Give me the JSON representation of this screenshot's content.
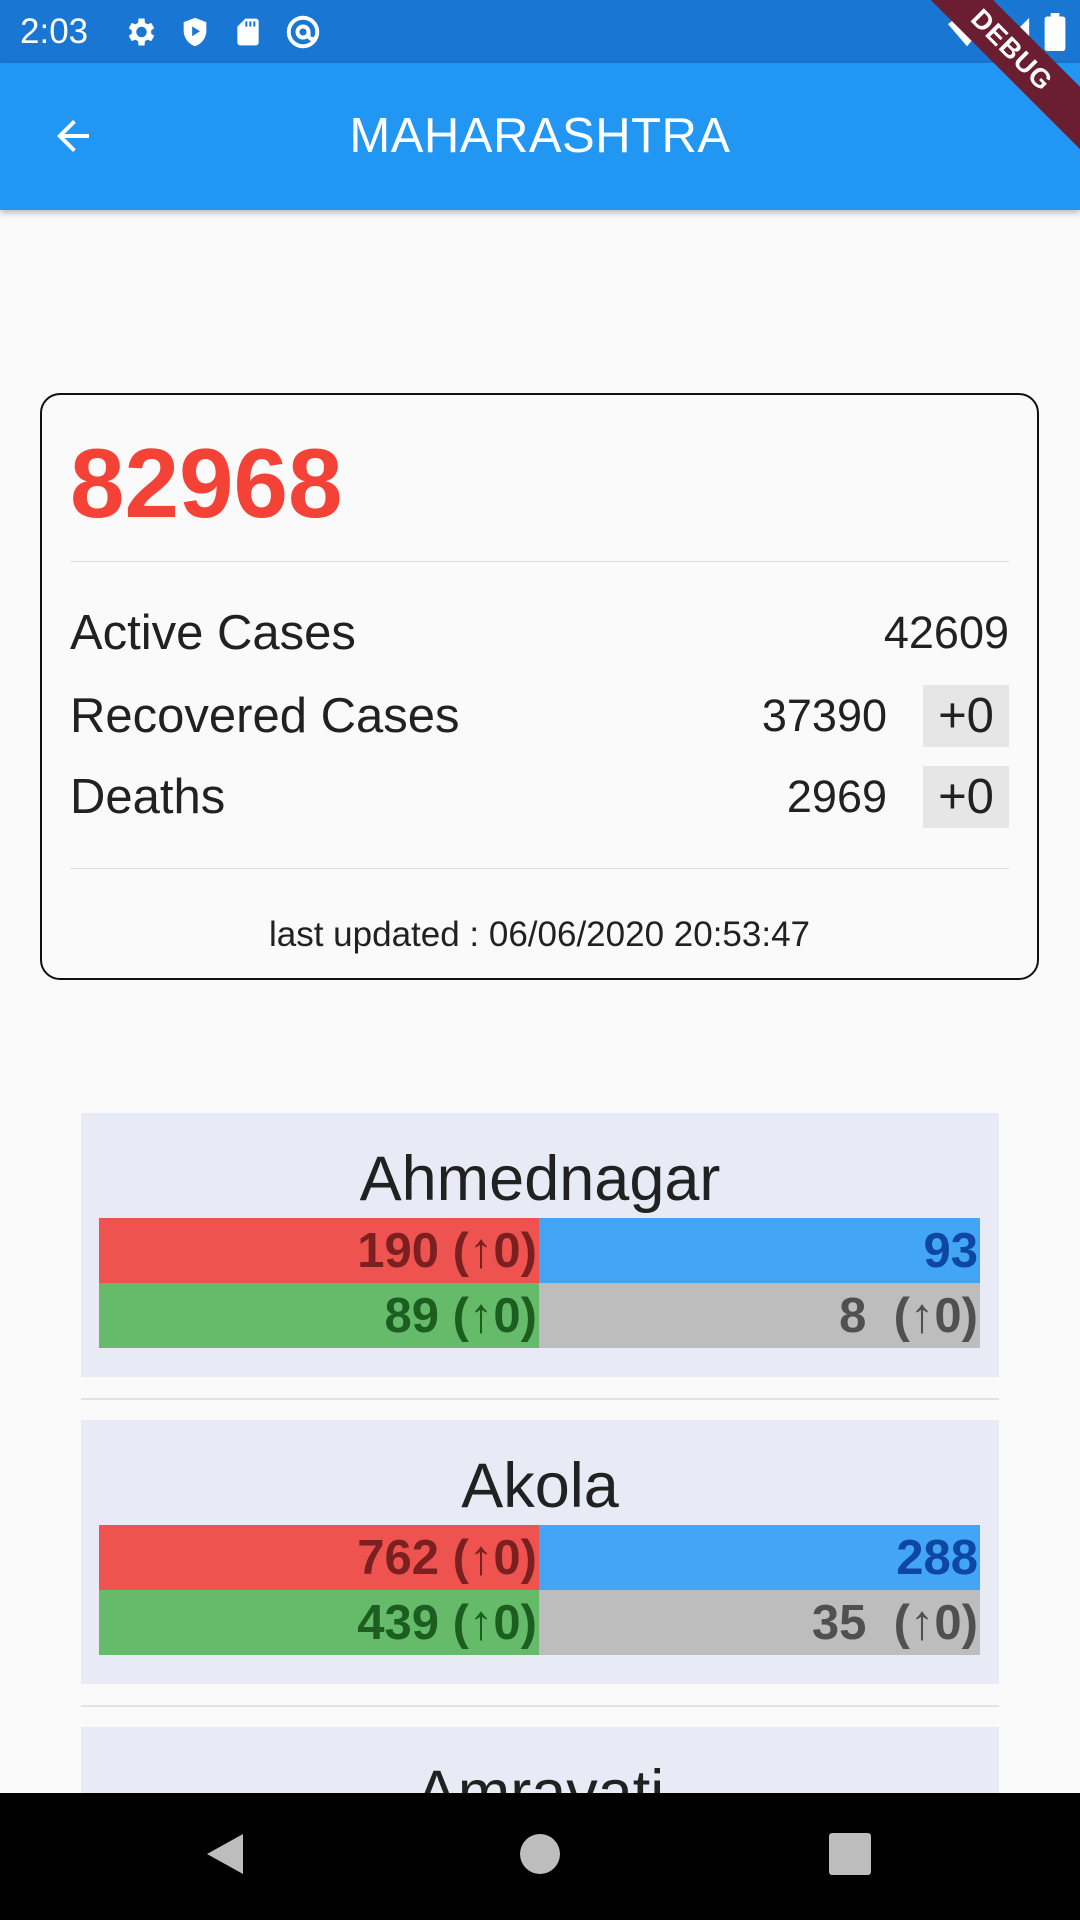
{
  "status_bar": {
    "time": "2:03"
  },
  "app_bar": {
    "title": "MAHARASHTRA",
    "debug_label": "DEBUG"
  },
  "summary": {
    "total": "82968",
    "rows": [
      {
        "label": "Active Cases",
        "value": "42609",
        "delta": ""
      },
      {
        "label": "Recovered Cases",
        "value": "37390",
        "delta": "+0"
      },
      {
        "label": "Deaths",
        "value": "2969",
        "delta": "+0"
      }
    ],
    "last_updated": "last updated : 06/06/2020 20:53:47"
  },
  "districts": [
    {
      "name": "Ahmednagar",
      "confirmed": "190 (↑0)",
      "active": "93",
      "recovered": "89 (↑0)",
      "deceased": "8  (↑0)"
    },
    {
      "name": "Akola",
      "confirmed": "762 (↑0)",
      "active": "288",
      "recovered": "439 (↑0)",
      "deceased": "35  (↑0)"
    },
    {
      "name": "Amravati",
      "confirmed": "",
      "active": "",
      "recovered": "",
      "deceased": ""
    }
  ],
  "colors": {
    "status_bar": "#1976d2",
    "app_bar": "#2196f3",
    "total": "#f44336",
    "confirmed": "#ef5350",
    "active": "#42a5f5",
    "recovered": "#66bb6a",
    "deceased": "#bdbdbd",
    "district_card": "#e8eaf6"
  },
  "icons": {
    "status": [
      "gear-icon",
      "shield-play-icon",
      "sd-card-icon",
      "at-sign-icon",
      "wifi-icon",
      "signal-icon",
      "battery-icon"
    ],
    "app_bar": "arrow-back-icon",
    "nav": [
      "nav-back-icon",
      "nav-home-icon",
      "nav-recents-icon"
    ]
  }
}
